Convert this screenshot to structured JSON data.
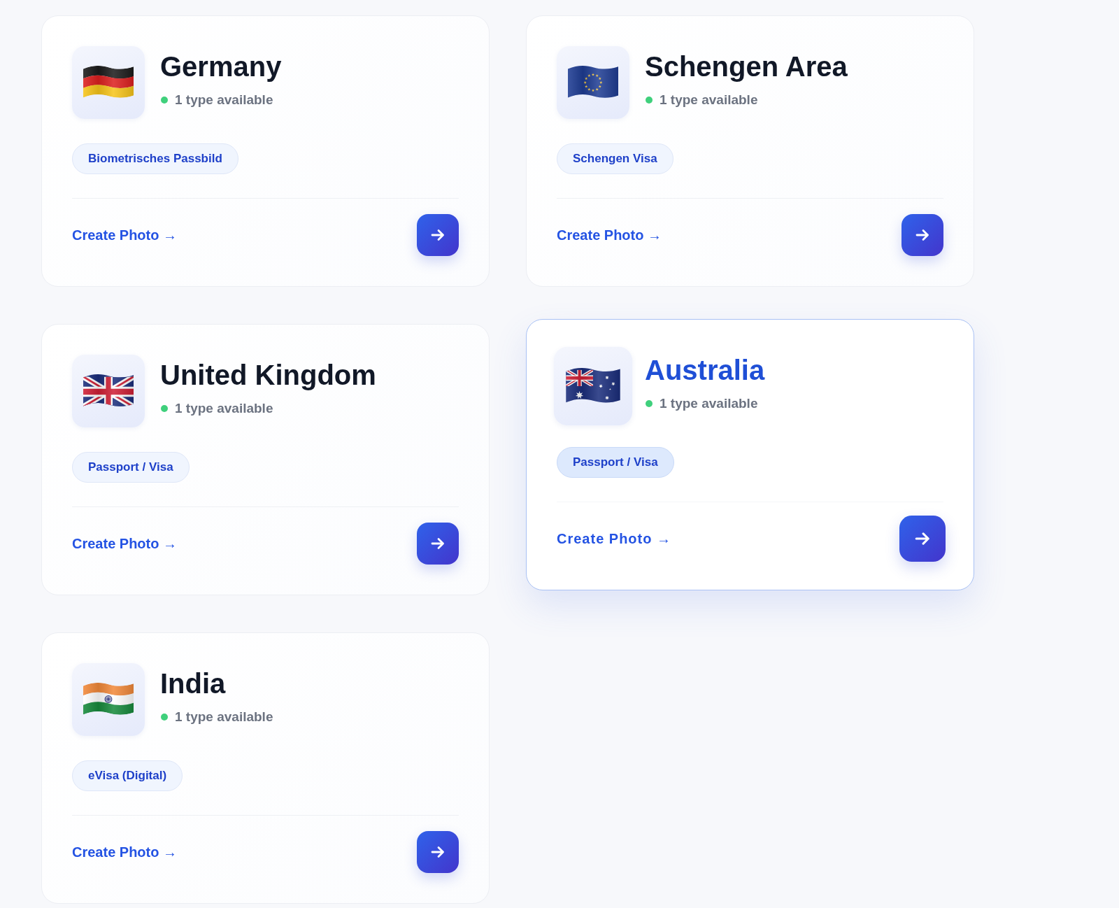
{
  "cards": [
    {
      "kind": "de",
      "title": "Germany",
      "status": "1 type available",
      "tag": "Biometrisches Passbild",
      "link": "Create Photo →",
      "hovered": false
    },
    {
      "kind": "eu",
      "title": "Schengen Area",
      "status": "1 type available",
      "tag": "Schengen Visa",
      "link": "Create Photo →",
      "hovered": false
    },
    {
      "kind": "gb",
      "title": "United Kingdom",
      "status": "1 type available",
      "tag": "Passport / Visa",
      "link": "Create Photo →",
      "hovered": false
    },
    {
      "kind": "au",
      "title": "Australia",
      "status": "1 type available",
      "tag": "Passport / Visa",
      "link": "Create Photo →",
      "hovered": true
    },
    {
      "kind": "in",
      "title": "India",
      "status": "1 type available",
      "tag": "eVisa (Digital)",
      "link": "Create Photo →",
      "hovered": false
    }
  ]
}
